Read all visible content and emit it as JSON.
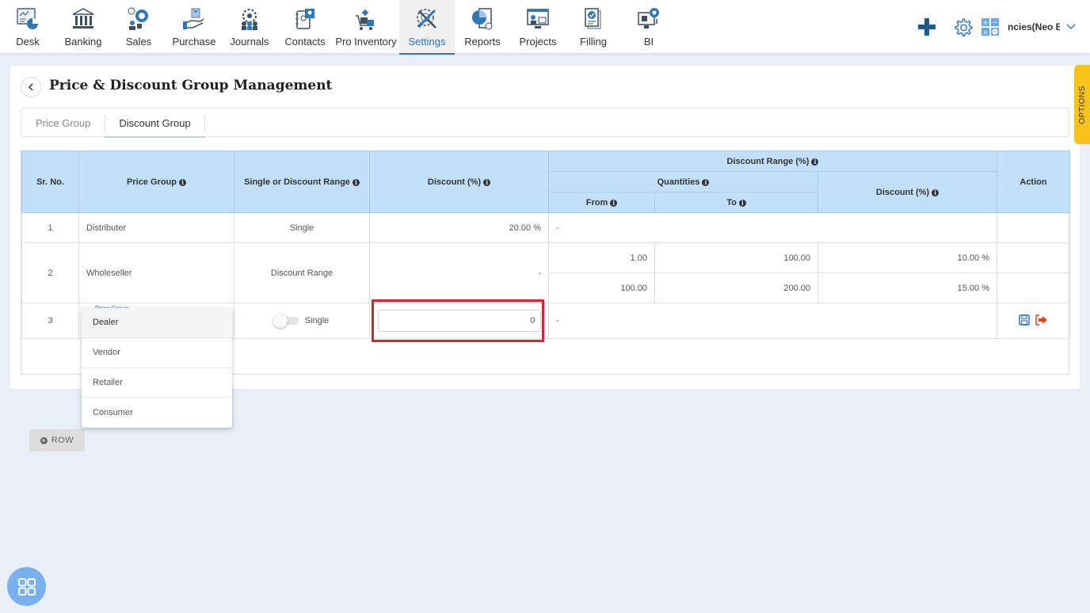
{
  "nav": {
    "items": [
      {
        "label": "Desk",
        "icon": "desk-icon"
      },
      {
        "label": "Banking",
        "icon": "bank-icon"
      },
      {
        "label": "Sales",
        "icon": "sales-icon"
      },
      {
        "label": "Purchase",
        "icon": "purchase-icon"
      },
      {
        "label": "Journals",
        "icon": "journals-icon"
      },
      {
        "label": "Contacts",
        "icon": "contacts-icon"
      },
      {
        "label": "Pro Inventory",
        "icon": "inventory-icon"
      },
      {
        "label": "Settings",
        "icon": "settings-icon",
        "active": true
      },
      {
        "label": "Reports",
        "icon": "reports-icon"
      },
      {
        "label": "Projects",
        "icon": "projects-icon"
      },
      {
        "label": "Filling",
        "icon": "filling-icon"
      },
      {
        "label": "BI",
        "icon": "bi-icon"
      }
    ],
    "company_name": "ncies(Neo Ba",
    "accent_color": "#2f77b5"
  },
  "page": {
    "title": "Price & Discount Group Management",
    "tabs": [
      {
        "label": "Price Group",
        "active": false
      },
      {
        "label": "Discount Group",
        "active": true
      }
    ],
    "options_label": "OPTIONS"
  },
  "table": {
    "headers": {
      "sr_no": "Sr. No.",
      "price_group": "Price Group",
      "single_or_range": "Single or Discount Range",
      "discount": "Discount (%)",
      "discount_range": "Discount Range (%)",
      "quantities": "Quantities",
      "from": "From",
      "to": "To",
      "range_discount": "Discount (%)",
      "action": "Action"
    },
    "rows": [
      {
        "sr": "1",
        "group": "Distributer",
        "type": "Single",
        "discount": "20.00 %",
        "range_placeholder": "-"
      },
      {
        "sr": "2",
        "group": "Wholeseller",
        "type": "Discount Range",
        "discount": "-",
        "ranges": [
          {
            "from": "1.00",
            "to": "100.00",
            "discount": "10.00 %"
          },
          {
            "from": "100.00",
            "to": "200.00",
            "discount": "15.00 %"
          }
        ]
      },
      {
        "sr": "3",
        "group_label": "Price Group",
        "type": "Single",
        "type_toggle_on": false,
        "discount_value": "0",
        "range_placeholder": "-"
      }
    ],
    "add_row_label": "ROW"
  },
  "dropdown": {
    "options": [
      "Dealer",
      "Vendor",
      "Retailer",
      "Consumer"
    ],
    "highlighted": "Dealer"
  }
}
